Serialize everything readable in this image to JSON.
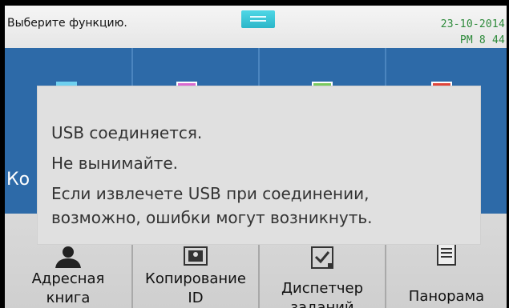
{
  "status": {
    "message": "Выберите функцию.",
    "date": "23-10-2014",
    "time": "PM 8  44"
  },
  "tiles": {
    "top_left_label": "Ко"
  },
  "bottom_tiles": [
    {
      "label_line1": "Адресная",
      "label_line2": "книга",
      "icon": "person-icon"
    },
    {
      "label_line1": "Копирование",
      "label_line2": "ID",
      "icon": "id-card-icon"
    },
    {
      "label_line1": "Диспетчер",
      "label_line2": "заданий",
      "icon": "checklist-icon"
    },
    {
      "label_line1": "Панорама",
      "label_line2": "",
      "icon": "document-stack-icon"
    }
  ],
  "dialog": {
    "line1": "USB соединяется.",
    "line2": "Не вынимайте.",
    "line3": "Если извлечете USB при соединении,",
    "line4": "возможно, ошибки могут возникнуть."
  },
  "colors": {
    "tile_blue": "#2d6aa8",
    "status_green": "#2d8a3a",
    "handle_cyan": "#2bb6c9"
  }
}
